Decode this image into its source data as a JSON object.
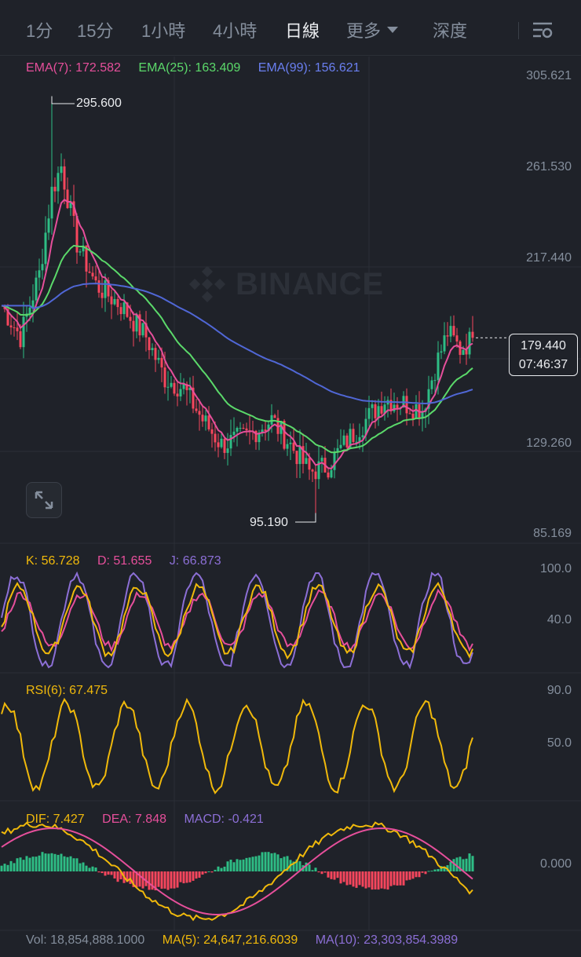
{
  "tabs": {
    "items": [
      "1分",
      "15分",
      "1小時",
      "4小時",
      "日線",
      "更多",
      "深度"
    ],
    "active": "日線"
  },
  "colors": {
    "up": "#2ebd85",
    "down": "#f6465d",
    "ema7": "#e64f9b",
    "ema25": "#5bd96a",
    "ema99": "#5067d6",
    "k": "#f0b90b",
    "d": "#e64f9b",
    "j": "#8c6fd6",
    "rsi": "#f0b90b"
  },
  "main": {
    "ema7": "EMA(7): 172.582",
    "ema25": "EMA(25): 163.409",
    "ema99": "EMA(99): 156.621",
    "axis": [
      "305.621",
      "261.530",
      "217.440",
      "129.260",
      "85.169"
    ],
    "high_label": "295.600",
    "low_label": "95.190",
    "last_price": "179.440",
    "countdown": "07:46:37",
    "watermark": "BINANCE"
  },
  "kdj": {
    "k": "K: 56.728",
    "d": "D: 51.655",
    "j": "J: 66.873",
    "axis": [
      "100.0",
      "40.0"
    ]
  },
  "rsi": {
    "label": "RSI(6): 67.475",
    "axis": [
      "90.0",
      "50.0"
    ]
  },
  "macd": {
    "dif": "DIF: 7.427",
    "dea": "DEA: 7.848",
    "macd": "MACD: -0.421",
    "axis": [
      "0.000"
    ]
  },
  "vol": {
    "vol": "Vol: 18,854,888.1000",
    "ma5": "MA(5): 24,647,216.6039",
    "ma10": "MA(10): 23,303,854.3989"
  },
  "chart_data": {
    "type": "candlestick",
    "y_axis_ticks": [
      305.621,
      261.53,
      217.44,
      129.26,
      85.169
    ],
    "high": 295.6,
    "low": 95.19,
    "last": 179.44,
    "ema": {
      "ema7": 172.582,
      "ema25": 163.409,
      "ema99": 156.621
    },
    "kdj": {
      "k": 56.728,
      "d": 51.655,
      "j": 66.873
    },
    "rsi6": 67.475,
    "macd": {
      "dif": 7.427,
      "dea": 7.848,
      "macd": -0.421
    }
  }
}
